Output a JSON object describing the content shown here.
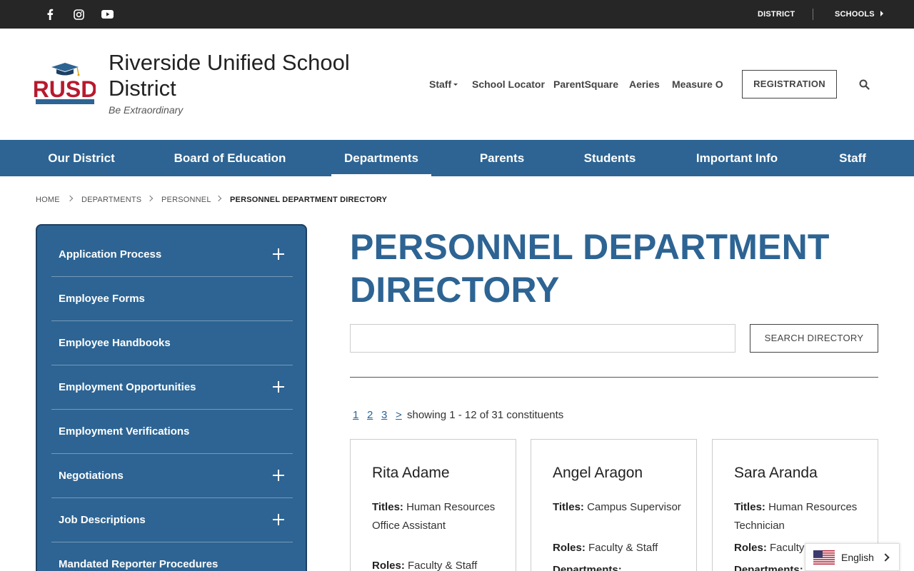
{
  "topbar": {
    "social_icons": [
      "facebook-icon",
      "instagram-icon",
      "youtube-icon"
    ],
    "district_label": "DISTRICT",
    "schools_label": "SCHOOLS"
  },
  "header": {
    "logo_text": "RUSD",
    "logo_subtext": "RIVERSIDE UNIFIED SCHOOL DISTRICT",
    "title": "Riverside Unified School District",
    "tagline": "Be Extraordinary",
    "nav": [
      "Staff",
      "School Locator",
      "ParentSquare",
      "Aeries",
      "Measure O"
    ],
    "registration_label": "REGISTRATION"
  },
  "mainnav": {
    "items": [
      "Our District",
      "Board of Education",
      "Departments",
      "Parents",
      "Students",
      "Important Info",
      "Staff"
    ],
    "active": "Departments"
  },
  "breadcrumb": [
    "HOME",
    "DEPARTMENTS",
    "PERSONNEL",
    "PERSONNEL DEPARTMENT DIRECTORY"
  ],
  "sidebar": {
    "items": [
      {
        "label": "Application Process",
        "expandable": true
      },
      {
        "label": "Employee Forms",
        "expandable": false
      },
      {
        "label": "Employee Handbooks",
        "expandable": false
      },
      {
        "label": "Employment Opportunities",
        "expandable": true
      },
      {
        "label": "Employment Verifications",
        "expandable": false
      },
      {
        "label": "Negotiations",
        "expandable": true
      },
      {
        "label": "Job Descriptions",
        "expandable": true
      },
      {
        "label": "Mandated Reporter Procedures",
        "expandable": false
      }
    ]
  },
  "page": {
    "title": "PERSONNEL DEPARTMENT DIRECTORY",
    "search_value": "",
    "search_button": "SEARCH DIRECTORY"
  },
  "pager": {
    "pages": [
      "1",
      "2",
      "3"
    ],
    "next": ">",
    "status": "showing 1 - 12 of 31 constituents"
  },
  "cards": [
    {
      "name": "Rita Adame",
      "titles_label": "Titles:",
      "titles": "Human Resources Office Assistant",
      "roles_label": "Roles:",
      "roles": "Faculty & Staff"
    },
    {
      "name": "Angel Aragon",
      "titles_label": "Titles:",
      "titles": "Campus Supervisor",
      "roles_label": "Roles:",
      "roles": "Faculty & Staff",
      "departments_label": "Departments:"
    },
    {
      "name": "Sara Aranda",
      "titles_label": "Titles:",
      "titles": "Human Resources Technician",
      "roles_label": "Roles:",
      "roles": "Faculty",
      "departments_label": "Departments:"
    }
  ],
  "language": {
    "label": "English",
    "flag": "us-flag-icon"
  },
  "colors": {
    "brand_blue": "#2d6493",
    "topbar_bg": "#262626",
    "logo_red": "#b8192e"
  }
}
